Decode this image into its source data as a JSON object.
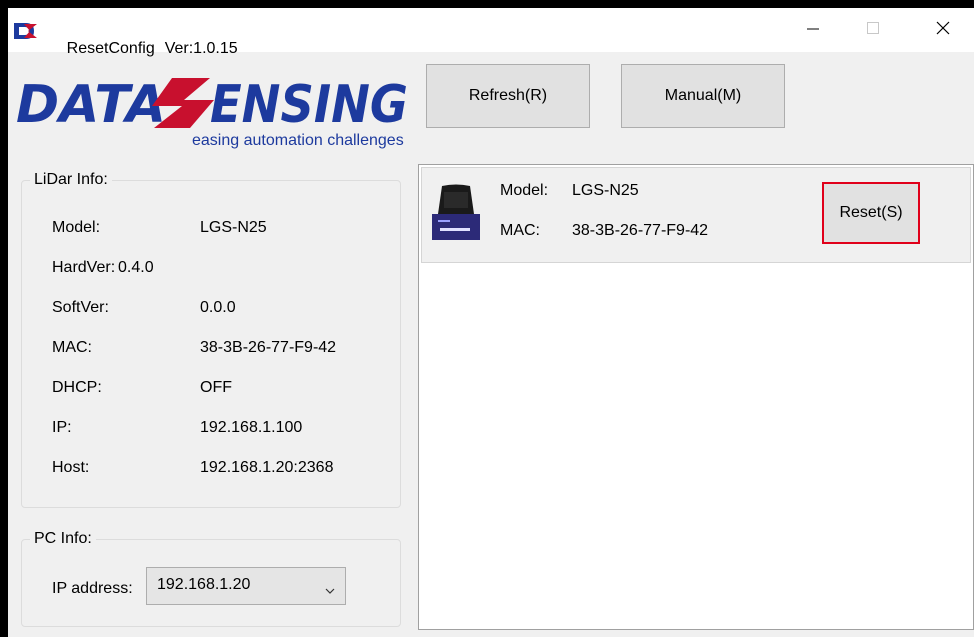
{
  "window": {
    "app_name": "ResetConfig",
    "version": "Ver:1.0.15"
  },
  "logo": {
    "wordmark": "DATASENSING",
    "tagline": "easing automation challenges",
    "colors": {
      "blue": "#1d3a9e",
      "red": "#c8102e"
    }
  },
  "toolbar": {
    "refresh_label": "Refresh(R)",
    "manual_label": "Manual(M)"
  },
  "lidar_info": {
    "legend": "LiDar Info:",
    "rows": [
      {
        "label": "Model:",
        "value": "LGS-N25"
      },
      {
        "label": "HardVer:",
        "value": "0.4.0"
      },
      {
        "label": "SoftVer:",
        "value": "0.0.0"
      },
      {
        "label": "MAC:",
        "value": "38-3B-26-77-F9-42"
      },
      {
        "label": "DHCP:",
        "value": "OFF"
      },
      {
        "label": "IP:",
        "value": "192.168.1.100"
      },
      {
        "label": "Host:",
        "value": "192.168.1.20:2368"
      }
    ]
  },
  "pc_info": {
    "legend": "PC Info:",
    "ip_label": "IP address:",
    "ip_selected": "192.168.1.20"
  },
  "devices": [
    {
      "model_label": "Model:",
      "model_value": "LGS-N25",
      "mac_label": "MAC:",
      "mac_value": "38-3B-26-77-F9-42",
      "reset_label": "Reset(S)"
    }
  ],
  "icons": [
    "app-icon",
    "minimize-icon",
    "maximize-icon",
    "close-icon",
    "chevron-down-icon",
    "lidar-device-icon"
  ],
  "accent": {
    "reset_highlight": "#e0001a"
  }
}
